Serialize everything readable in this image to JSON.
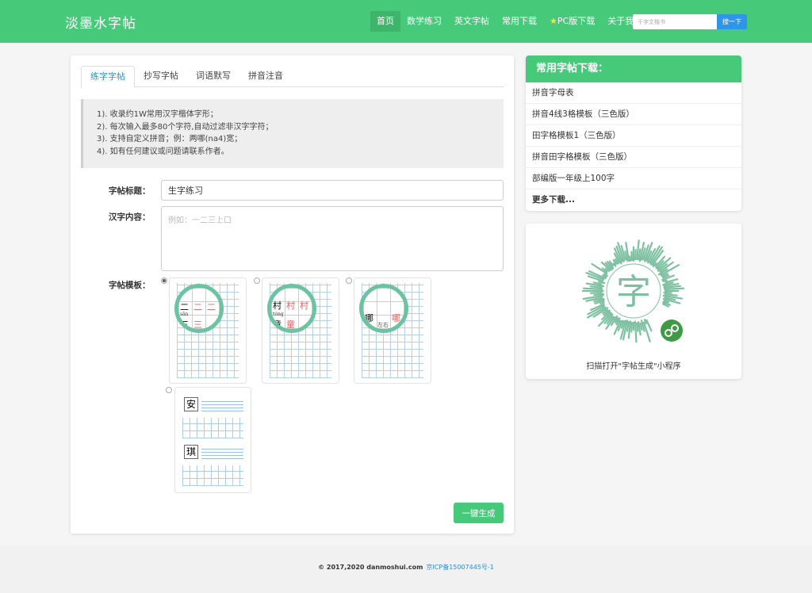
{
  "brand": "淡墨水字帖",
  "nav": [
    {
      "label": "首页",
      "active": true
    },
    {
      "label": "数学练习"
    },
    {
      "label": "英文字帖"
    },
    {
      "label": "常用下载"
    },
    {
      "label": "PC版下载",
      "icon": "star-icon"
    },
    {
      "label": "关于我"
    }
  ],
  "search": {
    "placeholder": "千字文楷书",
    "button": "搜一下"
  },
  "tabs": [
    {
      "label": "练字字帖",
      "active": true
    },
    {
      "label": "抄写字帖"
    },
    {
      "label": "词语默写"
    },
    {
      "label": "拼音注音"
    }
  ],
  "notice": [
    "1). 收录约1W常用汉字楷体字形；",
    "2). 每次输入最多80个字符,自动过滤非汉字字符；",
    "3). 支持自定义拼音；例：两哪(na4)宽；",
    "4). 如有任何建议或问题请联系作者。"
  ],
  "form": {
    "title_label": "字帖标题：",
    "title_value": "生字练习",
    "content_label": "汉字内容：",
    "content_placeholder": "例如：一二三上口",
    "template_label": "字帖模板：",
    "submit": "一键生成"
  },
  "templates": [
    {
      "selected": true,
      "magnifier": {
        "chars": [
          "二",
          "二",
          "二",
          "三",
          "三"
        ],
        "pinyin": "sān"
      }
    },
    {
      "selected": false,
      "magnifier": {
        "chars": [
          "村",
          "村",
          "村",
          "童",
          "童"
        ],
        "pinyin": "tóng"
      }
    },
    {
      "selected": false,
      "magnifier": {
        "chars": [
          "哪",
          "哪",
          "左右"
        ]
      }
    },
    {
      "selected": false,
      "rows": [
        "安",
        "琪"
      ]
    }
  ],
  "downloads": {
    "title": "常用字帖下载：",
    "items": [
      "拼音字母表",
      "拼音4线3格模板（三色版）",
      "田字格模板1（三色版）",
      "拼音田字格模板（三色版）",
      "部编版一年级上100字"
    ],
    "more": "更多下载..."
  },
  "miniprogram": {
    "qr_char": "字",
    "caption": "扫描打开\"字帖生成\"小程序"
  },
  "footer": {
    "copyright": "© 2017,2020 danmoshui.com",
    "icp": "京ICP备15007445号-1"
  },
  "colors": {
    "primary": "#47c97a",
    "link": "#2f8ed8",
    "search_button": "#2e96e8",
    "magnifier_ring": "#6cc3a1"
  }
}
